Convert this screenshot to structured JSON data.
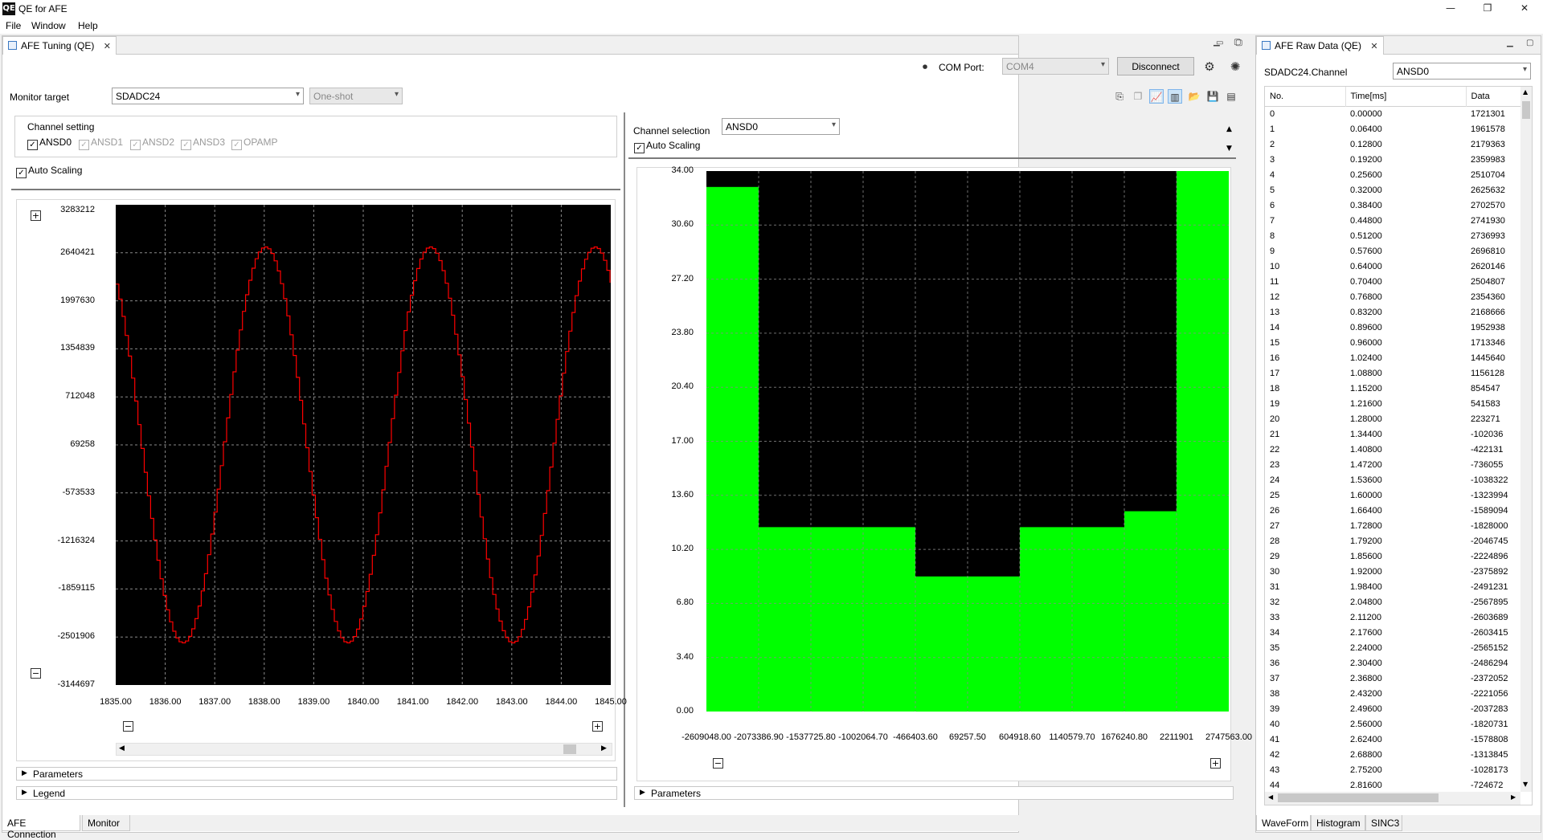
{
  "window": {
    "title": "QE for AFE",
    "app_icon_text": "QE",
    "controls": {
      "minimize": "—",
      "maximize": "❐",
      "close": "✕"
    }
  },
  "menu": [
    "File",
    "Window",
    "Help"
  ],
  "tuning_view": {
    "tab_label": "AFE Tuning (QE)",
    "com_port_label": "COM Port:",
    "com_port_value": "COM4",
    "disconnect_label": "Disconnect",
    "monitor_target_label": "Monitor target",
    "monitor_target_value": "SDADC24",
    "mode_value": "One-shot",
    "channel_setting_label": "Channel setting",
    "channels": [
      {
        "label": "ANSD0",
        "checked": true,
        "enabled": true
      },
      {
        "label": "ANSD1",
        "checked": true,
        "enabled": false
      },
      {
        "label": "ANSD2",
        "checked": true,
        "enabled": false
      },
      {
        "label": "ANSD3",
        "checked": true,
        "enabled": false
      },
      {
        "label": "OPAMP",
        "checked": true,
        "enabled": false
      }
    ],
    "auto_scaling_label": "Auto Scaling",
    "parameters_label": "Parameters",
    "legend_label": "Legend",
    "histogram": {
      "channel_selection_label": "Channel selection",
      "channel_value": "ANSD0",
      "auto_scaling_label": "Auto Scaling",
      "parameters_label": "Parameters"
    },
    "bottom_tabs": [
      "AFE Connection",
      "Monitor"
    ]
  },
  "raw_view": {
    "tab_label": "AFE Raw Data (QE)",
    "channel_label": "SDADC24.Channel",
    "channel_value": "ANSD0",
    "columns": [
      "No.",
      "Time[ms]",
      "Data"
    ],
    "rows": [
      [
        "0",
        "0.00000",
        "1721301"
      ],
      [
        "1",
        "0.06400",
        "1961578"
      ],
      [
        "2",
        "0.12800",
        "2179363"
      ],
      [
        "3",
        "0.19200",
        "2359983"
      ],
      [
        "4",
        "0.25600",
        "2510704"
      ],
      [
        "5",
        "0.32000",
        "2625632"
      ],
      [
        "6",
        "0.38400",
        "2702570"
      ],
      [
        "7",
        "0.44800",
        "2741930"
      ],
      [
        "8",
        "0.51200",
        "2736993"
      ],
      [
        "9",
        "0.57600",
        "2696810"
      ],
      [
        "10",
        "0.64000",
        "2620146"
      ],
      [
        "11",
        "0.70400",
        "2504807"
      ],
      [
        "12",
        "0.76800",
        "2354360"
      ],
      [
        "13",
        "0.83200",
        "2168666"
      ],
      [
        "14",
        "0.89600",
        "1952938"
      ],
      [
        "15",
        "0.96000",
        "1713346"
      ],
      [
        "16",
        "1.02400",
        "1445640"
      ],
      [
        "17",
        "1.08800",
        "1156128"
      ],
      [
        "18",
        "1.15200",
        "854547"
      ],
      [
        "19",
        "1.21600",
        "541583"
      ],
      [
        "20",
        "1.28000",
        "223271"
      ],
      [
        "21",
        "1.34400",
        "-102036"
      ],
      [
        "22",
        "1.40800",
        "-422131"
      ],
      [
        "23",
        "1.47200",
        "-736055"
      ],
      [
        "24",
        "1.53600",
        "-1038322"
      ],
      [
        "25",
        "1.60000",
        "-1323994"
      ],
      [
        "26",
        "1.66400",
        "-1589094"
      ],
      [
        "27",
        "1.72800",
        "-1828000"
      ],
      [
        "28",
        "1.79200",
        "-2046745"
      ],
      [
        "29",
        "1.85600",
        "-2224896"
      ],
      [
        "30",
        "1.92000",
        "-2375892"
      ],
      [
        "31",
        "1.98400",
        "-2491231"
      ],
      [
        "32",
        "2.04800",
        "-2567895"
      ],
      [
        "33",
        "2.11200",
        "-2603689"
      ],
      [
        "34",
        "2.17600",
        "-2603415"
      ],
      [
        "35",
        "2.24000",
        "-2565152"
      ],
      [
        "36",
        "2.30400",
        "-2486294"
      ],
      [
        "37",
        "2.36800",
        "-2372052"
      ],
      [
        "38",
        "2.43200",
        "-2221056"
      ],
      [
        "39",
        "2.49600",
        "-2037283"
      ],
      [
        "40",
        "2.56000",
        "-1820731"
      ],
      [
        "41",
        "2.62400",
        "-1578808"
      ],
      [
        "42",
        "2.68800",
        "-1313845"
      ],
      [
        "43",
        "2.75200",
        "-1028173"
      ],
      [
        "44",
        "2.81600",
        "-724672"
      ]
    ],
    "bottom_tabs": [
      "WaveForm",
      "Histogram",
      "SINC3"
    ]
  },
  "chart_data": [
    {
      "type": "line",
      "y_ticks": [
        "3283212",
        "2640421",
        "1997630",
        "1354839",
        "712048",
        "69258",
        "-573533",
        "-1216324",
        "-1859115",
        "-2501906",
        "-3144697"
      ],
      "x_ticks": [
        "1835.00",
        "1836.00",
        "1837.00",
        "1838.00",
        "1839.00",
        "1840.00",
        "1841.00",
        "1842.00",
        "1843.00",
        "1844.00",
        "1845.00"
      ],
      "xlim": [
        1835.0,
        1845.0
      ],
      "ylim": [
        -3144697,
        3283212
      ],
      "series": [
        {
          "waveform": "sine",
          "amplitude": 2650000,
          "offset": 69000,
          "period": 3.33,
          "peaks_at": [
            1838.0,
            1841.35,
            1844.7
          ],
          "color": "#ff0000"
        }
      ],
      "background": "#000000",
      "grid": true
    },
    {
      "type": "bar",
      "y_ticks": [
        "34.00",
        "30.60",
        "27.20",
        "23.80",
        "20.40",
        "17.00",
        "13.60",
        "10.20",
        "6.80",
        "3.40",
        "0.00"
      ],
      "x_ticks": [
        "-2609048.00",
        "-2073386.90",
        "-1537725.80",
        "-1002064.70",
        "-466403.60",
        "69257.50",
        "604918.60",
        "1140579.70",
        "1676240.80",
        "2211901",
        "2747563.00"
      ],
      "values": [
        33,
        11.6,
        11.6,
        11.6,
        8.5,
        8.5,
        11.6,
        11.6,
        12.6,
        34
      ],
      "ylim": [
        0,
        34
      ],
      "bar_color": "#00ff00",
      "background": "#000000",
      "grid": true
    }
  ]
}
